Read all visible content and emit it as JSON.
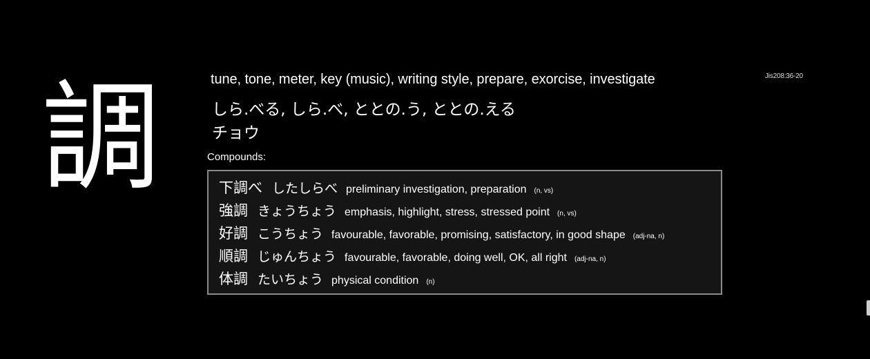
{
  "kanji": "調",
  "jis_code": "Jis208:36-20",
  "meanings": "tune, tone, meter, key (music), writing style, prepare, exorcise, investigate",
  "kun_readings": "しら.べる, しら.べ, ととの.う, ととの.える",
  "on_readings": "チョウ",
  "compounds_label": "Compounds:",
  "compounds": [
    {
      "word": "下調べ",
      "reading": "したしらべ",
      "meaning": "preliminary investigation, preparation",
      "pos": "(n, vs)"
    },
    {
      "word": "強調",
      "reading": "きょうちょう",
      "meaning": "emphasis, highlight, stress, stressed point",
      "pos": "(n, vs)"
    },
    {
      "word": "好調",
      "reading": "こうちょう",
      "meaning": "favourable, favorable, promising, satisfactory, in good shape",
      "pos": "(adj-na, n)"
    },
    {
      "word": "順調",
      "reading": "じゅんちょう",
      "meaning": "favourable, favorable, doing well, OK, all right",
      "pos": "(adj-na, n)"
    },
    {
      "word": "体調",
      "reading": "たいちょう",
      "meaning": "physical condition",
      "pos": "(n)"
    }
  ]
}
